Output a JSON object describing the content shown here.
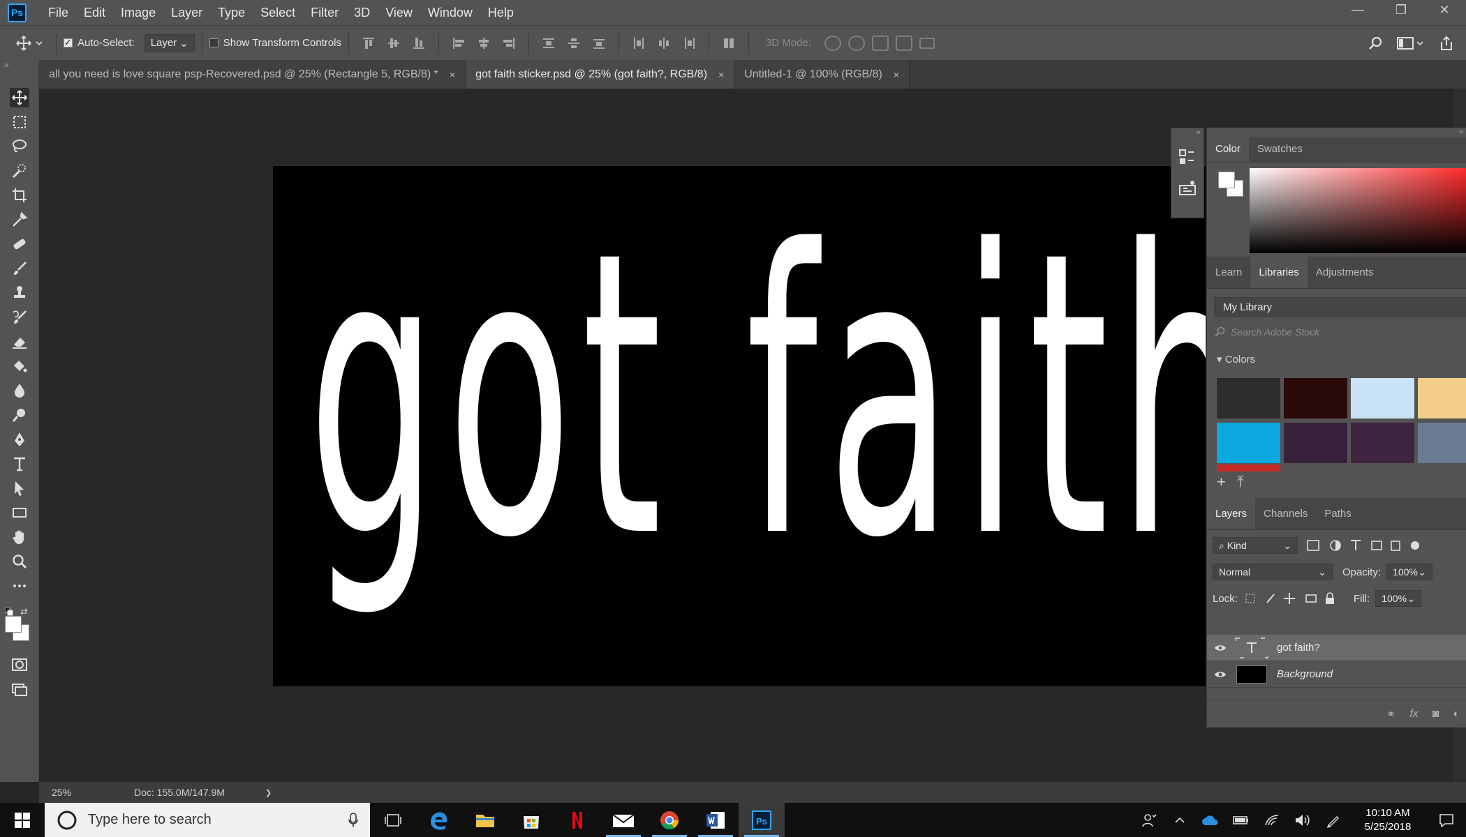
{
  "app": {
    "logo": "Ps"
  },
  "menu": [
    "File",
    "Edit",
    "Image",
    "Layer",
    "Type",
    "Select",
    "Filter",
    "3D",
    "View",
    "Window",
    "Help"
  ],
  "window_controls": [
    "—",
    "❐",
    "✕"
  ],
  "options": {
    "auto_select_label": "Auto-Select:",
    "auto_select_checked": true,
    "auto_select_target": "Layer",
    "show_transform_label": "Show Transform Controls",
    "show_transform_checked": false,
    "mode_3d_label": "3D Mode:"
  },
  "tabs": [
    {
      "title": "all you need is love square psp-Recovered.psd @ 25% (Rectangle 5, RGB/8) *",
      "close": "×",
      "active": false
    },
    {
      "title": "got faith sticker.psd @ 25% (got faith?, RGB/8)",
      "close": "×",
      "active": true
    },
    {
      "title": "Untitled-1 @ 100% (RGB/8)",
      "close": "×",
      "active": false
    }
  ],
  "canvas": {
    "text": "got faith?",
    "background": "#000000",
    "text_color": "#ffffff"
  },
  "color_panel": {
    "tabs": [
      "Color",
      "Swatches"
    ],
    "active_tab": "Color",
    "foreground": "#ffffff",
    "background": "#ffffff"
  },
  "libraries_panel": {
    "tabs": [
      "Learn",
      "Libraries",
      "Adjustments"
    ],
    "active_tab": "Libraries",
    "library": "My Library",
    "search_placeholder": "Search Adobe Stock",
    "colors_label": "Colors",
    "swatches": [
      "#2d2d2d",
      "#2b0a0a",
      "#c9e2f5",
      "#f3cd8a",
      "#0ba9e0",
      "#37213a",
      "#3d2540",
      "#6b7b94"
    ]
  },
  "layers_panel": {
    "tabs": [
      "Layers",
      "Channels",
      "Paths"
    ],
    "active_tab": "Layers",
    "filter": "Kind",
    "blend_mode": "Normal",
    "opacity_label": "Opacity:",
    "opacity": "100%",
    "lock_label": "Lock:",
    "fill_label": "Fill:",
    "fill": "100%",
    "layers": [
      {
        "name": "got faith?",
        "type": "text",
        "selected": true
      },
      {
        "name": "Background",
        "type": "pixel",
        "selected": false
      }
    ]
  },
  "status": {
    "zoom": "25%",
    "doc": "Doc: 155.0M/147.9M",
    "arrow": "❯"
  },
  "taskbar": {
    "search_placeholder": "Type here to search",
    "time": "10:10 AM",
    "date": "5/25/2018"
  }
}
